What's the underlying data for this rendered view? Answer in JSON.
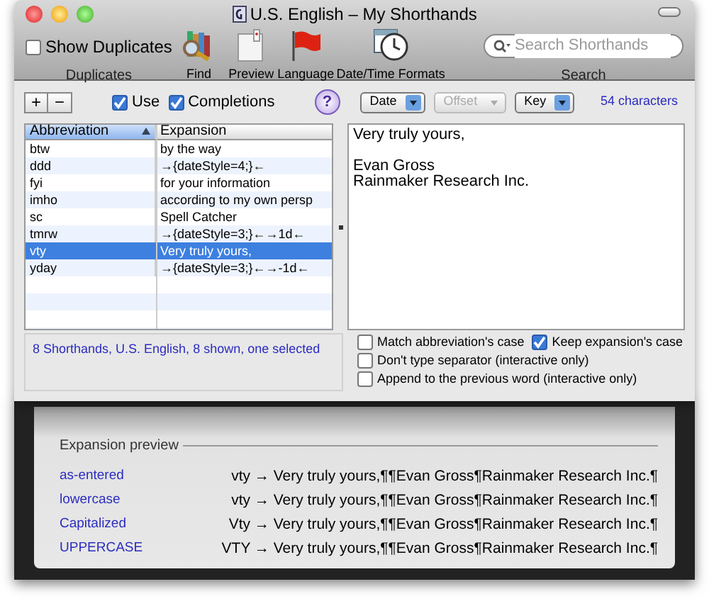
{
  "window": {
    "title": "U.S. English – My Shorthands"
  },
  "toolbar": {
    "show_duplicates": {
      "label": "Show Duplicates",
      "checked": false,
      "caption": "Duplicates"
    },
    "buttons": [
      {
        "kind": "find",
        "label": "Find"
      },
      {
        "kind": "preview",
        "label": "Preview"
      },
      {
        "kind": "language",
        "label": "Language"
      },
      {
        "kind": "datetime",
        "label": "Date/Time Formats"
      }
    ],
    "search": {
      "placeholder": "Search Shorthands",
      "caption": "Search"
    }
  },
  "controls": {
    "add": "+",
    "remove": "−",
    "use": {
      "label": "Use",
      "checked": true
    },
    "completions": {
      "label": "Completions",
      "checked": true
    },
    "help": "?",
    "popups": [
      {
        "label": "Date",
        "disabled": false
      },
      {
        "label": "Offset",
        "disabled": true
      },
      {
        "label": "Key",
        "disabled": false
      }
    ],
    "char_count": "54 characters"
  },
  "table": {
    "columns": [
      {
        "label": "Abbreviation",
        "sorted": true
      },
      {
        "label": "Expansion",
        "sorted": false
      }
    ],
    "rows": [
      {
        "cells": [
          "btw",
          "by the way"
        ],
        "selected": false
      },
      {
        "cells": [
          "ddd",
          "→{dateStyle=4;}←"
        ],
        "selected": false
      },
      {
        "cells": [
          "fyi",
          "for your information"
        ],
        "selected": false
      },
      {
        "cells": [
          "imho",
          "according to my own persp"
        ],
        "selected": false
      },
      {
        "cells": [
          "sc",
          "Spell Catcher"
        ],
        "selected": false
      },
      {
        "cells": [
          "tmrw",
          "→{dateStyle=3;}←→1d←"
        ],
        "selected": false
      },
      {
        "cells": [
          "vty",
          "Very truly yours,"
        ],
        "selected": true
      },
      {
        "cells": [
          "yday",
          "→{dateStyle=3;}←→-1d←"
        ],
        "selected": false
      }
    ]
  },
  "status": "8 Shorthands, U.S. English, 8 shown, one selected",
  "editor": {
    "text": "Very truly yours,\n\nEvan Gross\nRainmaker Research Inc."
  },
  "option_rows": [
    [
      {
        "label": "Match abbreviation's case",
        "checked": false
      },
      {
        "label": "Keep expansion's case",
        "checked": true
      }
    ],
    [
      {
        "label": "Don't type separator (interactive only)",
        "checked": false
      }
    ],
    [
      {
        "label": "Append to the previous word (interactive only)",
        "checked": false
      }
    ]
  ],
  "preview": {
    "title": "Expansion preview",
    "rows": [
      {
        "case": "as-entered",
        "result": "vty → Very truly yours,¶¶Evan Gross¶Rainmaker Research Inc.¶"
      },
      {
        "case": "lowercase",
        "result": "vty → Very truly yours,¶¶Evan Gross¶Rainmaker Research Inc.¶"
      },
      {
        "case": "Capitalized",
        "result": "Vty → Very truly yours,¶¶Evan Gross¶Rainmaker Research Inc.¶"
      },
      {
        "case": "UPPERCASE",
        "result": "VTY → Very truly yours,¶¶Evan Gross¶Rainmaker Research Inc.¶"
      }
    ]
  }
}
